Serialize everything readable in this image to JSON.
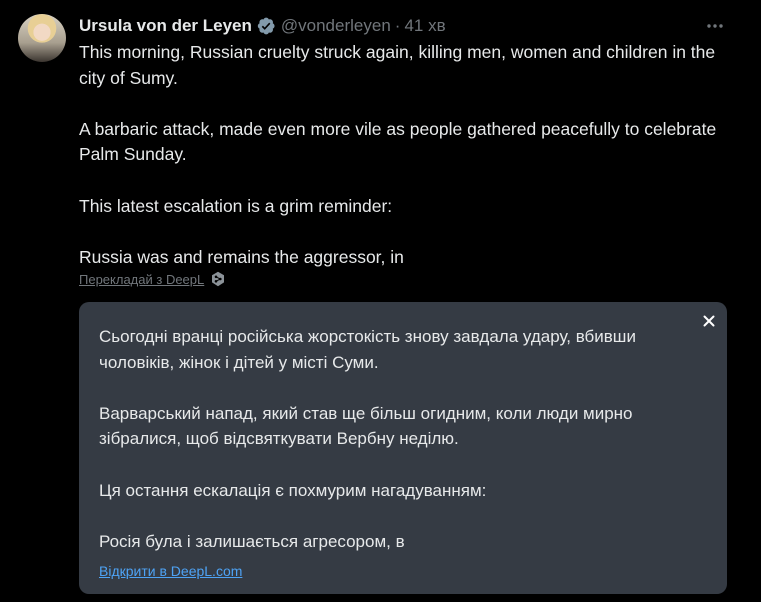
{
  "author": {
    "name": "Ursula von der Leyen",
    "handle": "@vonderleyen",
    "separator": "·",
    "time": "41 хв"
  },
  "tweet": {
    "paragraphs": [
      "This morning, Russian cruelty struck again, killing men, women and children in the city of Sumy.",
      "A barbaric attack, made even more vile as people gathered peacefully to celebrate Palm Sunday.",
      "This latest escalation is a grim reminder:",
      "Russia was and remains the aggressor, in"
    ]
  },
  "translate": {
    "link_label": "Перекладай з DeepL",
    "icon": "deepl-icon"
  },
  "translation_card": {
    "paragraphs": [
      "Сьогодні вранці російська жорстокість знову завдала удару, вбивши чоловіків, жінок і дітей у місті Суми.",
      "Варварський напад, який став ще більш огидним, коли люди мирно зібралися, щоб відсвяткувати Вербну неділю.",
      "Ця остання ескалація є похмурим нагадуванням:",
      "Росія була і залишається агресором, в"
    ],
    "open_link": "Відкрити в DeepL.com",
    "close_icon": "close-icon"
  },
  "colors": {
    "background": "#000000",
    "text": "#e7e9ea",
    "muted": "#71767b",
    "card": "#353b44",
    "link": "#4ea3f5",
    "verified": "#829aab"
  }
}
